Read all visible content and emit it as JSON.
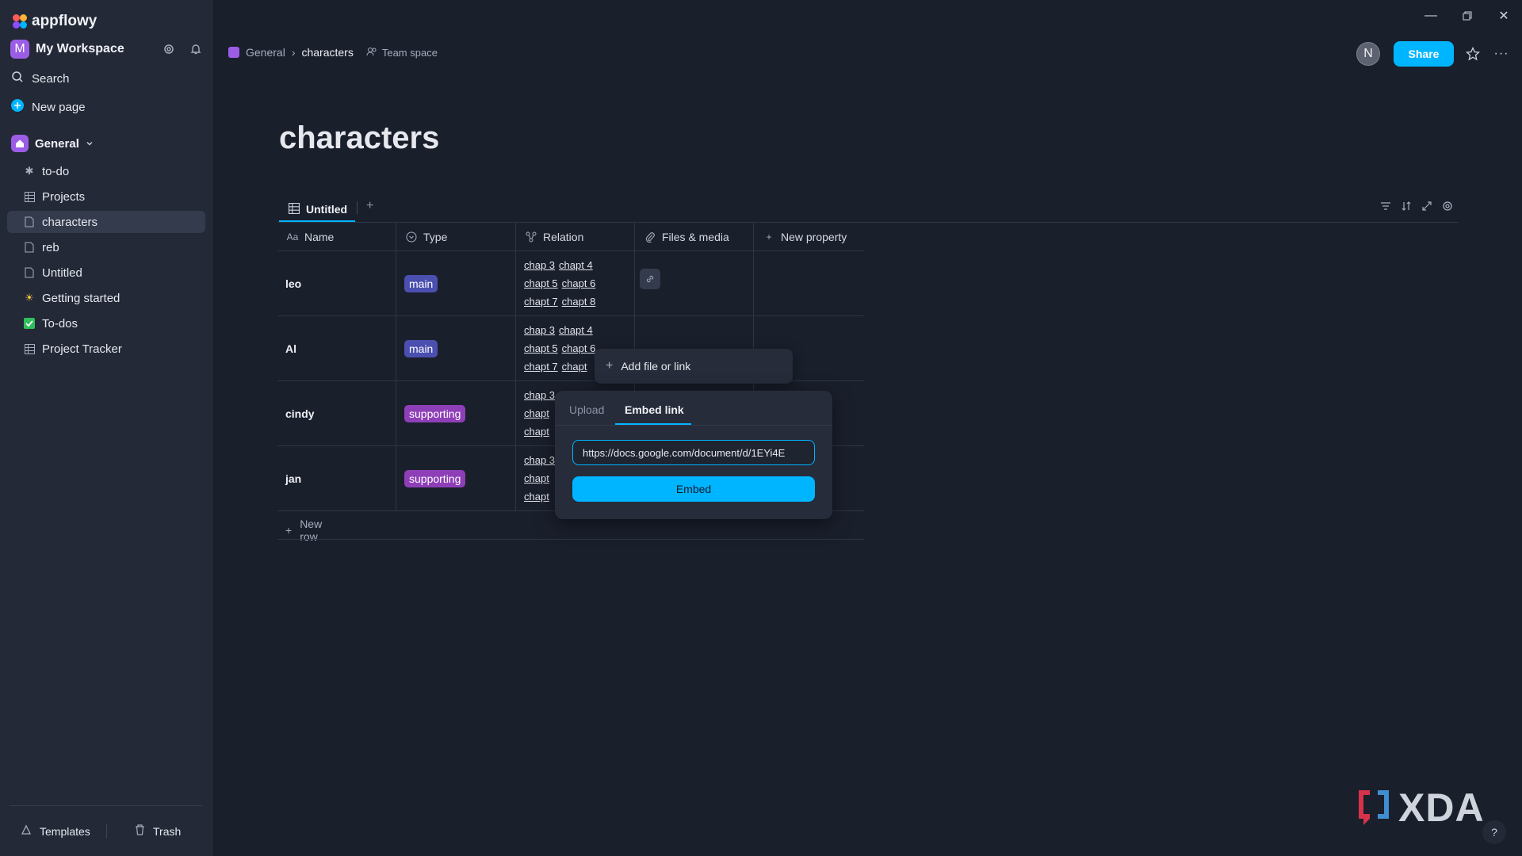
{
  "app": {
    "name": "appflowy"
  },
  "workspace": {
    "initial": "M",
    "name": "My Workspace"
  },
  "nav": {
    "search": "Search",
    "new_page": "New page"
  },
  "section": {
    "label": "General"
  },
  "tree": [
    {
      "label": "to-do",
      "icon": "bug-icon"
    },
    {
      "label": "Projects",
      "icon": "grid-icon"
    },
    {
      "label": "characters",
      "icon": "page-icon",
      "active": true
    },
    {
      "label": "reb",
      "icon": "page-icon"
    },
    {
      "label": "Untitled",
      "icon": "page-icon"
    },
    {
      "label": "Getting started",
      "icon": "sun-emoji-icon"
    },
    {
      "label": "To-dos",
      "icon": "check-emoji-icon"
    },
    {
      "label": "Project Tracker",
      "icon": "grid-icon"
    }
  ],
  "footer": {
    "templates": "Templates",
    "trash": "Trash"
  },
  "breadcrumb": {
    "root": "General",
    "current": "characters",
    "space": "Team space"
  },
  "header": {
    "avatar": "N",
    "share": "Share"
  },
  "page": {
    "title": "characters"
  },
  "view": {
    "tab": "Untitled",
    "add": "+"
  },
  "table": {
    "columns": [
      "Name",
      "Type",
      "Relation",
      "Files & media",
      "New property"
    ],
    "rows": [
      {
        "name": "leo",
        "type": "main",
        "relations": [
          [
            "chap 3",
            "chapt 4"
          ],
          [
            "chapt 5",
            "chapt 6"
          ],
          [
            "chapt 7",
            "chapt 8"
          ]
        ],
        "has_link": true
      },
      {
        "name": "Al",
        "type": "main",
        "relations": [
          [
            "chap 3",
            "chapt 4"
          ],
          [
            "chapt 5",
            "chapt 6"
          ],
          [
            "chapt 7",
            "chapt"
          ]
        ],
        "has_link": false
      },
      {
        "name": "cindy",
        "type": "supporting",
        "relations": [
          [
            "chap 3"
          ],
          [
            "chapt"
          ],
          [
            "chapt"
          ]
        ],
        "has_link": false
      },
      {
        "name": "jan",
        "type": "supporting",
        "relations": [
          [
            "chap 3"
          ],
          [
            "chapt"
          ],
          [
            "chapt"
          ]
        ],
        "has_link": false
      }
    ],
    "new_row": "New row"
  },
  "tag_colors": {
    "main": "#4a4fb0",
    "supporting": "#8e3fb8"
  },
  "popup": {
    "add_file": "Add file or link",
    "tab_upload": "Upload",
    "tab_embed": "Embed link",
    "url_value": "https://docs.google.com/document/d/1EYi4E",
    "embed_button": "Embed"
  },
  "watermark": {
    "text": "XDA"
  },
  "help": "?"
}
